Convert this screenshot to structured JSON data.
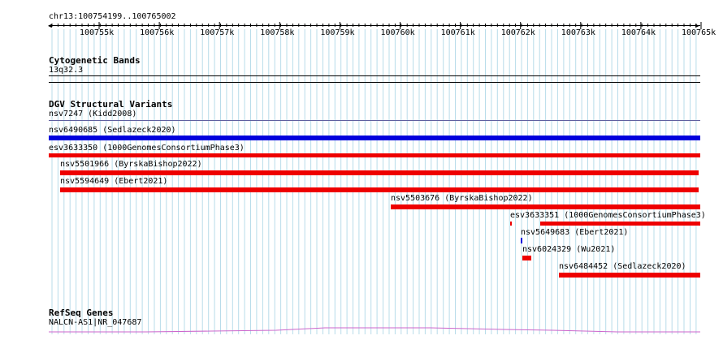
{
  "ruler": {
    "location": "chr13:100754199..100765002",
    "ticks": [
      "100755k",
      "100756k",
      "100757k",
      "100758k",
      "100759k",
      "100760k",
      "100761k",
      "100762k",
      "100763k",
      "100764k",
      "100765k"
    ]
  },
  "tracks": {
    "cytoband": {
      "title": "Cytogenetic Bands",
      "band": "13q32.3"
    },
    "dgv": {
      "title": "DGV Structural Variants",
      "variants": [
        {
          "id": "v0",
          "label": "nsv7247 (Kidd2008)",
          "color": "#6060a0"
        },
        {
          "id": "v1",
          "label": "nsv6490685 (Sedlazeck2020)",
          "color": "#0000dd"
        },
        {
          "id": "v2",
          "label": "esv3633350 (1000GenomesConsortiumPhase3)",
          "color": "#ee0000"
        },
        {
          "id": "v3",
          "label": "nsv5501966 (ByrskaBishop2022)",
          "color": "#ee0000"
        },
        {
          "id": "v4",
          "label": "nsv5594649 (Ebert2021)",
          "color": "#ee0000"
        },
        {
          "id": "v5",
          "label": "nsv5503676 (ByrskaBishop2022)",
          "color": "#ee0000"
        },
        {
          "id": "v6",
          "label": "esv3633351 (1000GenomesConsortiumPhase3)",
          "color": "#ee0000"
        },
        {
          "id": "v7",
          "label": "nsv5649683 (Ebert2021)",
          "color": "#0000dd"
        },
        {
          "id": "v8",
          "label": "nsv6024329 (Wu2021)",
          "color": "#ee0000"
        },
        {
          "id": "v9",
          "label": "nsv6484452 (Sedlazeck2020)",
          "color": "#ee0000"
        }
      ]
    },
    "refseq": {
      "title": "RefSeq Genes",
      "gene": "NALCN-AS1|NR_047687",
      "color": "#cc66cc"
    }
  }
}
